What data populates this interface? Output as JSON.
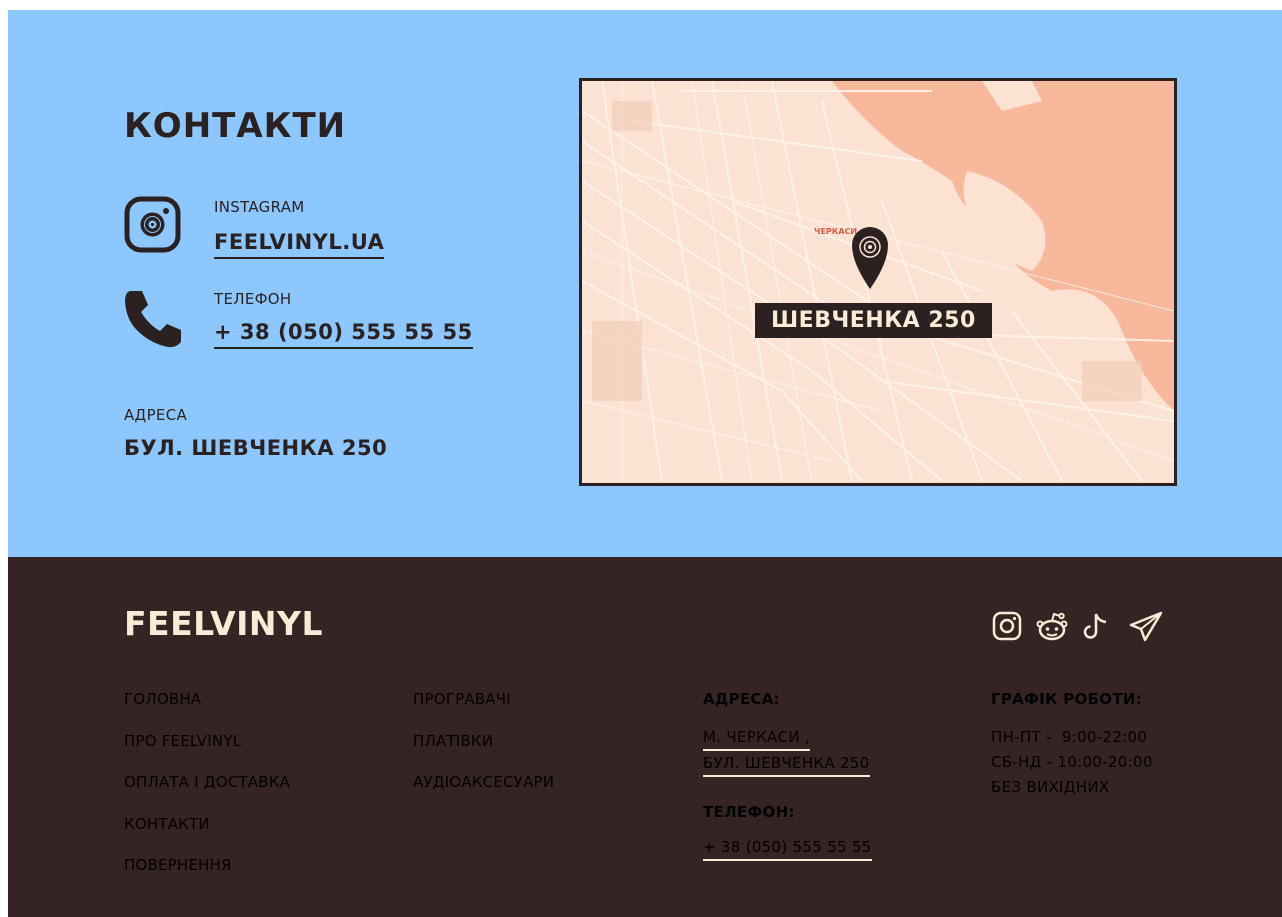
{
  "contacts": {
    "title": "КОНТАКТИ",
    "instagram_label": "INSTAGRAM",
    "instagram_handle": "FEELVINYL.UA",
    "phone_label": "ТЕЛЕФОН",
    "phone": "+ 38 (050) 555 55 55",
    "address_label": "АДРЕСА",
    "address": "БУЛ. ШЕВЧЕНКА 250"
  },
  "map": {
    "city_label": "ЧЕРКАСИ",
    "pin_label": "ШЕВЧЕНКА 250",
    "land_color": "#fbe2d3",
    "water_color": "#f7b89c"
  },
  "footer": {
    "logo": "FEELVINYL",
    "nav_col1": [
      "ГОЛОВНА",
      "ПРО FEELVINYL",
      "ОПЛАТА І ДОСТАВКА",
      "КОНТАКТИ",
      "ПОВЕРНЕННЯ"
    ],
    "nav_col2": [
      "ПРОГРАВАЧІ",
      "ПЛАТІВКИ",
      "АУДІОАКСЕСУАРИ"
    ],
    "address_title": "АДРЕСА:",
    "address_line1": "М. ЧЕРКАСИ ,",
    "address_line2": "БУЛ. ШЕВЧЕНКА 250",
    "phone_title": "ТЕЛЕФОН:",
    "phone": "+ 38 (050) 555 55 55",
    "schedule_title": "ГРАФІК РОБОТИ:",
    "schedule": [
      "ПН-ПТ -  9:00-22:00",
      "СБ-НД - 10:00-20:00",
      "БЕЗ ВИХІДНИХ"
    ],
    "social_icons": [
      "instagram-icon",
      "reddit-icon",
      "tiktok-icon",
      "telegram-icon"
    ]
  },
  "colors": {
    "contacts_bg": "#8cc7ff",
    "footer_bg": "#352423",
    "dark_text": "#2b2120",
    "light_text": "#f8ecd6"
  }
}
